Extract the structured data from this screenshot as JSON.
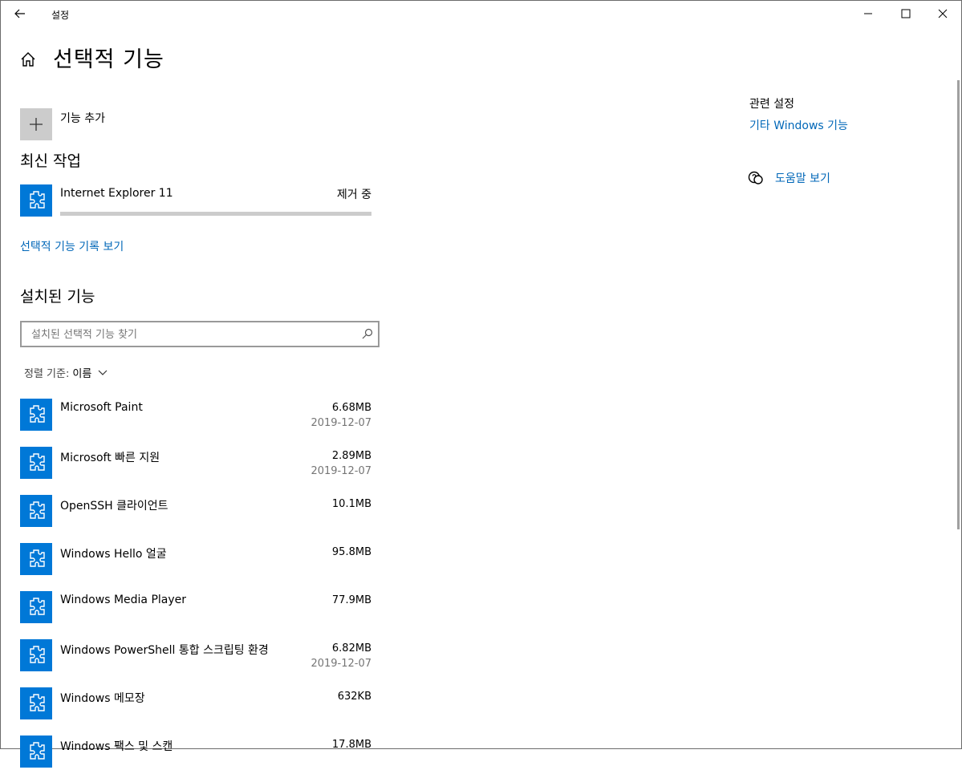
{
  "window": {
    "title": "설정"
  },
  "page": {
    "title": "선택적 기능"
  },
  "add_feature": {
    "label": "기능 추가"
  },
  "recent": {
    "title": "최신 작업",
    "item": {
      "name": "Internet Explorer 11",
      "status": "제거 중",
      "progress": 1.0
    },
    "history_link": "선택적 기능 기록 보기"
  },
  "installed": {
    "title": "설치된 기능",
    "search_placeholder": "설치된 선택적 기능 찾기",
    "sort_label": "정렬 기준:",
    "sort_value": "이름",
    "items": [
      {
        "name": "Microsoft Paint",
        "size": "6.68MB",
        "date": "2019-12-07"
      },
      {
        "name": "Microsoft 빠른 지원",
        "size": "2.89MB",
        "date": "2019-12-07"
      },
      {
        "name": "OpenSSH 클라이언트",
        "size": "10.1MB",
        "date": ""
      },
      {
        "name": "Windows Hello 얼굴",
        "size": "95.8MB",
        "date": ""
      },
      {
        "name": "Windows Media Player",
        "size": "77.9MB",
        "date": ""
      },
      {
        "name": "Windows PowerShell 통합 스크립팅 환경",
        "size": "6.82MB",
        "date": "2019-12-07"
      },
      {
        "name": "Windows 메모장",
        "size": "632KB",
        "date": ""
      },
      {
        "name": "Windows 팩스 및 스캔",
        "size": "17.8MB",
        "date": ""
      }
    ]
  },
  "related": {
    "title": "관련 설정",
    "link": "기타 Windows 기능",
    "help": "도움말 보기"
  },
  "colors": {
    "accent": "#0078d7",
    "link": "#0067b8"
  }
}
